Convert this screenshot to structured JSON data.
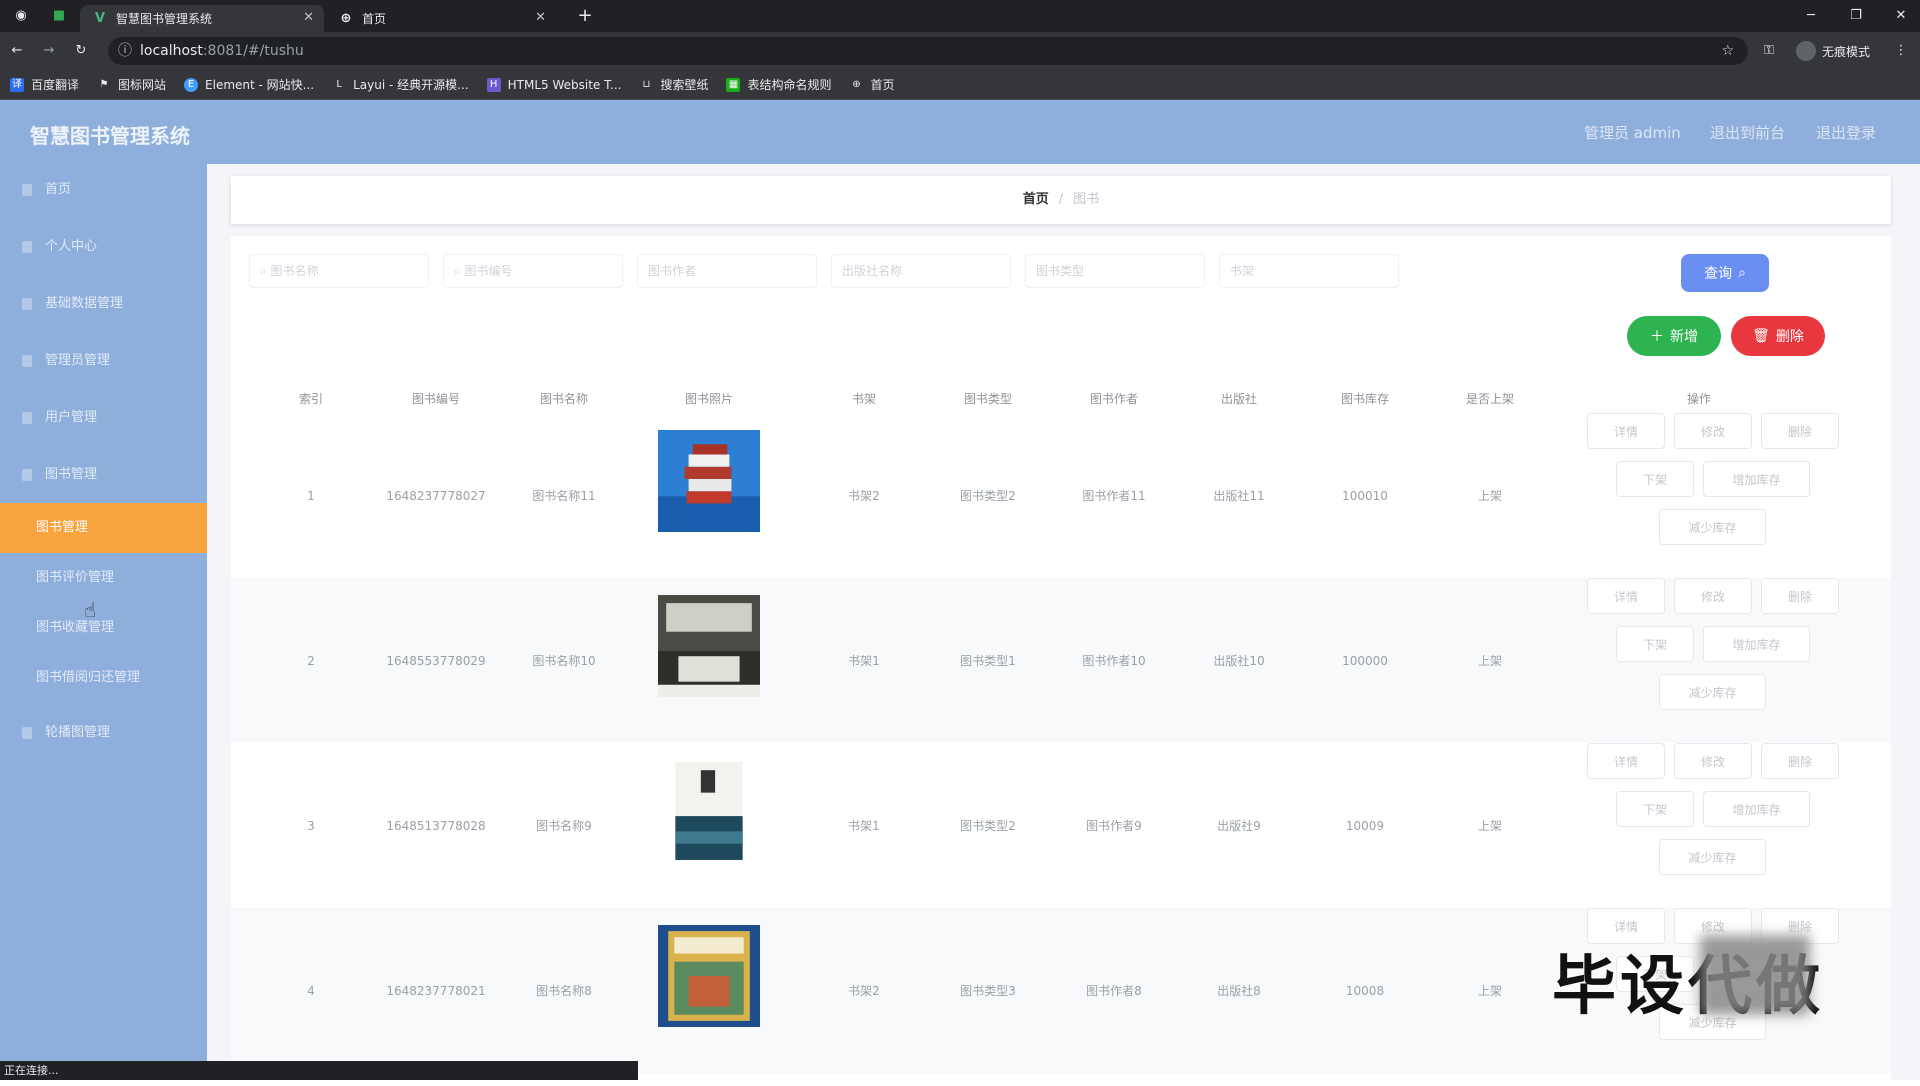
{
  "browser": {
    "tabs": [
      {
        "title": "智慧图书管理系统",
        "active": true
      },
      {
        "title": "首页",
        "active": false
      }
    ],
    "url_host": "localhost",
    "url_path": ":8081/#/tushu",
    "incognito_label": "无痕模式",
    "bookmarks": [
      "百度翻译",
      "图标网站",
      "Element - 网站快...",
      "Layui - 经典开源模...",
      "HTML5 Website T...",
      "搜索壁纸",
      "表结构命名规则",
      "首页"
    ],
    "status_text": "正在连接..."
  },
  "header": {
    "title": "智慧图书管理系统",
    "admin_label": "管理员 admin",
    "links": [
      "退出到前台",
      "退出登录"
    ]
  },
  "sidebar": {
    "items": [
      {
        "label": "首页",
        "active": false,
        "sub": false
      },
      {
        "label": "个人中心",
        "active": false,
        "sub": false
      },
      {
        "label": "基础数据管理",
        "active": false,
        "sub": false
      },
      {
        "label": "管理员管理",
        "active": false,
        "sub": false
      },
      {
        "label": "用户管理",
        "active": false,
        "sub": false
      },
      {
        "label": "图书管理",
        "active": false,
        "sub": false
      },
      {
        "label": "图书管理",
        "active": true,
        "sub": true
      },
      {
        "label": "图书评价管理",
        "active": false,
        "sub": true
      },
      {
        "label": "图书收藏管理",
        "active": false,
        "sub": true
      },
      {
        "label": "图书借阅归还管理",
        "active": false,
        "sub": true
      },
      {
        "label": "轮播图管理",
        "active": false,
        "sub": false
      }
    ]
  },
  "breadcrumb": {
    "home": "首页",
    "current": "图书"
  },
  "search": {
    "placeholders": [
      "图书名称",
      "图书编号",
      "图书作者",
      "出版社名称",
      "图书类型",
      "书架"
    ],
    "query_label": "查询",
    "add_label": "新增",
    "delete_label": "删除"
  },
  "table": {
    "columns": [
      "索引",
      "图书编号",
      "图书名称",
      "图书照片",
      "书架",
      "图书类型",
      "图书作者",
      "出版社",
      "图书库存",
      "是否上架",
      "操作"
    ],
    "rows": [
      {
        "index": "1",
        "code": "1648237778027",
        "name": "图书名称11",
        "shelf": "书架2",
        "type": "图书类型2",
        "author": "图书作者11",
        "publisher": "出版社11",
        "stock": "100010",
        "status": "上架"
      },
      {
        "index": "2",
        "code": "1648553778029",
        "name": "图书名称10",
        "shelf": "书架1",
        "type": "图书类型1",
        "author": "图书作者10",
        "publisher": "出版社10",
        "stock": "100000",
        "status": "上架"
      },
      {
        "index": "3",
        "code": "1648513778028",
        "name": "图书名称9",
        "shelf": "书架1",
        "type": "图书类型2",
        "author": "图书作者9",
        "publisher": "出版社9",
        "stock": "10009",
        "status": "上架"
      },
      {
        "index": "4",
        "code": "1648237778021",
        "name": "图书名称8",
        "shelf": "书架2",
        "type": "图书类型3",
        "author": "图书作者8",
        "publisher": "出版社8",
        "stock": "10008",
        "status": "上架"
      }
    ],
    "actions": [
      "详情",
      "修改",
      "删除",
      "下架",
      "增加库存",
      "减少库存"
    ]
  },
  "watermark": "毕设代做",
  "colors": {
    "header": "#8eaedc",
    "active_menu": "#f7a43f",
    "query": "#6b8ef2",
    "add": "#2eb351",
    "delete": "#e9373f"
  }
}
